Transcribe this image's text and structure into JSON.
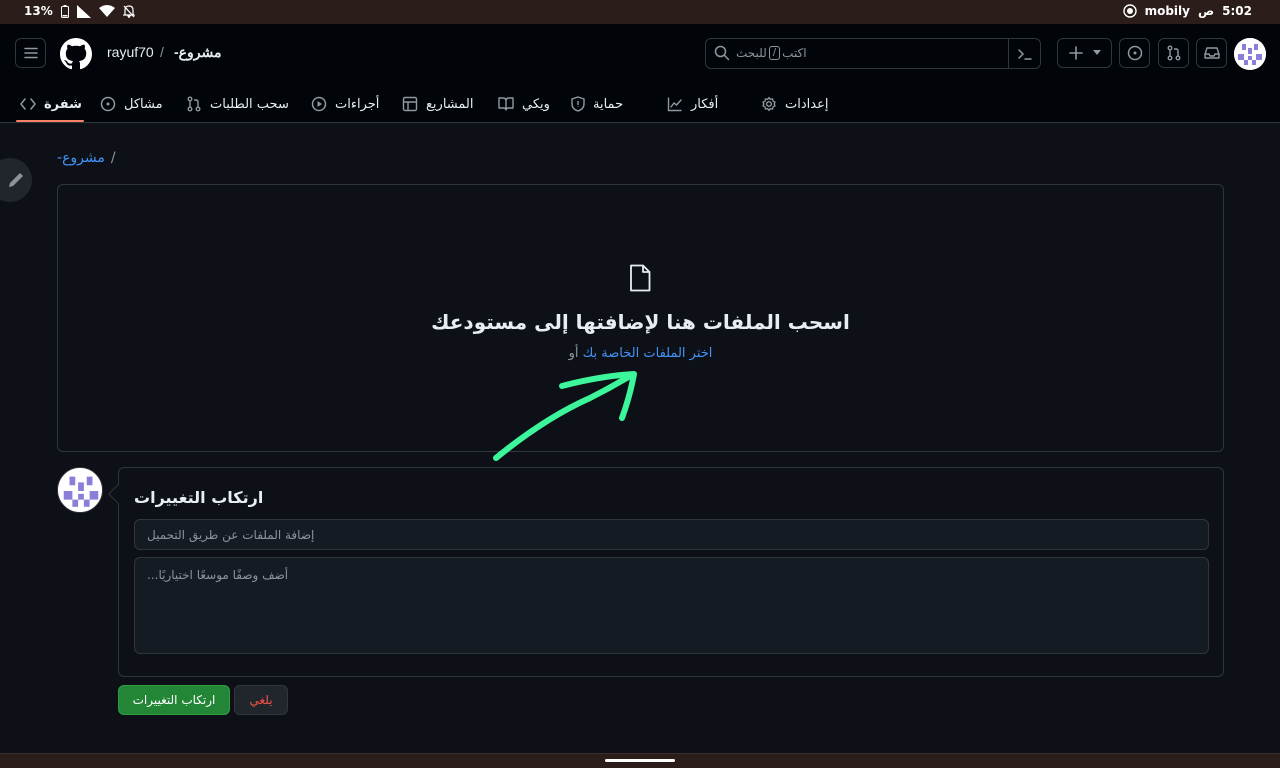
{
  "status_bar": {
    "battery": "13%",
    "time": "5:02",
    "ampm": "ص",
    "carrier": "mobily"
  },
  "header": {
    "owner": "rayuf70",
    "separator": "/",
    "repo": "-مشروع",
    "search_text": "اكتب",
    "search_key": "/",
    "search_after": "للبحث"
  },
  "tabs": [
    {
      "label": "شفرة",
      "icon": "code-icon",
      "active": true
    },
    {
      "label": "مشاكل",
      "icon": "issue-icon"
    },
    {
      "label": "سحب الطلبات",
      "icon": "pull-request-icon"
    },
    {
      "label": "أجراءات",
      "icon": "play-icon"
    },
    {
      "label": "المشاريع",
      "icon": "table-icon"
    },
    {
      "label": "ويكي",
      "icon": "book-icon"
    },
    {
      "label": "حماية",
      "icon": "shield-icon"
    },
    {
      "label": "أفكار",
      "icon": "graph-icon"
    },
    {
      "label": "إعدادات",
      "icon": "gear-icon"
    }
  ],
  "breadcrumb": {
    "repo": "-مشروع",
    "sep": "/"
  },
  "dropzone": {
    "title": "اسحب الملفات هنا لإضافتها إلى مستودعك",
    "choose_link": "اختر الملفات الخاصة بك",
    "or": "أو"
  },
  "commit": {
    "title": "ارتكاب التغييرات",
    "summary_placeholder": "إضافة الملفات عن طريق التحميل",
    "description_placeholder": "أضف وصفًا موسعًا اختياريًا...",
    "commit_button": "ارتكاب التغييرات",
    "cancel_button": "يلغي"
  },
  "colors": {
    "background": "#0d1117",
    "header": "#010409",
    "link": "#4493f8",
    "primary_button": "#238636",
    "danger": "#f85149",
    "annotation_arrow": "#3df59a"
  }
}
